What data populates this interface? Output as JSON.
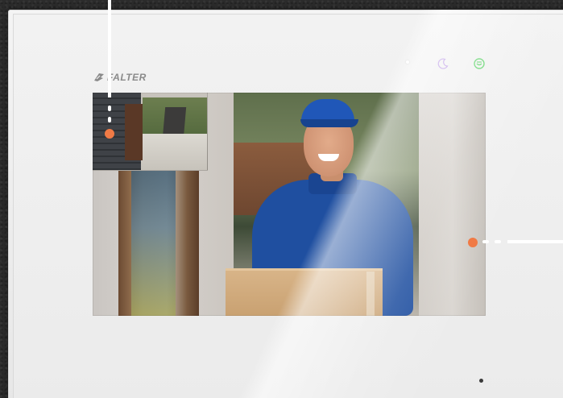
{
  "brand": {
    "name": "FALTER"
  },
  "indicators": {
    "led": {
      "icon": "led-dot",
      "color": "#ffffff"
    },
    "night_mode": {
      "icon": "moon-icon",
      "color": "#b995e6"
    },
    "unlock": {
      "icon": "unlock-icon",
      "color": "#5fd46a"
    }
  },
  "screen": {
    "main_view": "courier-with-package",
    "pip_view": "entrance-camera"
  },
  "callouts": {
    "marker_color": "#f07a45",
    "line_color": "#ffffff"
  }
}
